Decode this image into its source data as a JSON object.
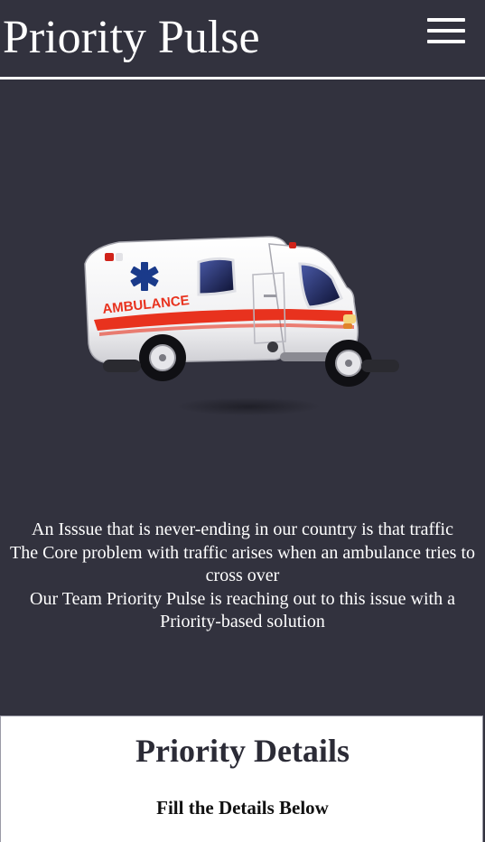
{
  "header": {
    "title": "Priority Pulse",
    "menu_icon": "hamburger-menu-icon"
  },
  "hero": {
    "image_icon": "ambulance-illustration",
    "vehicle_text": "AMBULANCE"
  },
  "intro": {
    "lines": [
      "An Isssue that is never-ending in our country is that traffic",
      "The Core problem with traffic arises when an ambulance tries to cross over",
      "Our Team Priority Pulse is reaching out to this issue with a Priority-based solution"
    ]
  },
  "details": {
    "title": "Priority Details",
    "subtitle": "Fill the Details Below"
  },
  "colors": {
    "background": "#32323e",
    "card": "#ffffff",
    "ambulance_stripe": "#e8321e",
    "star_of_life": "#1a3a8a"
  }
}
